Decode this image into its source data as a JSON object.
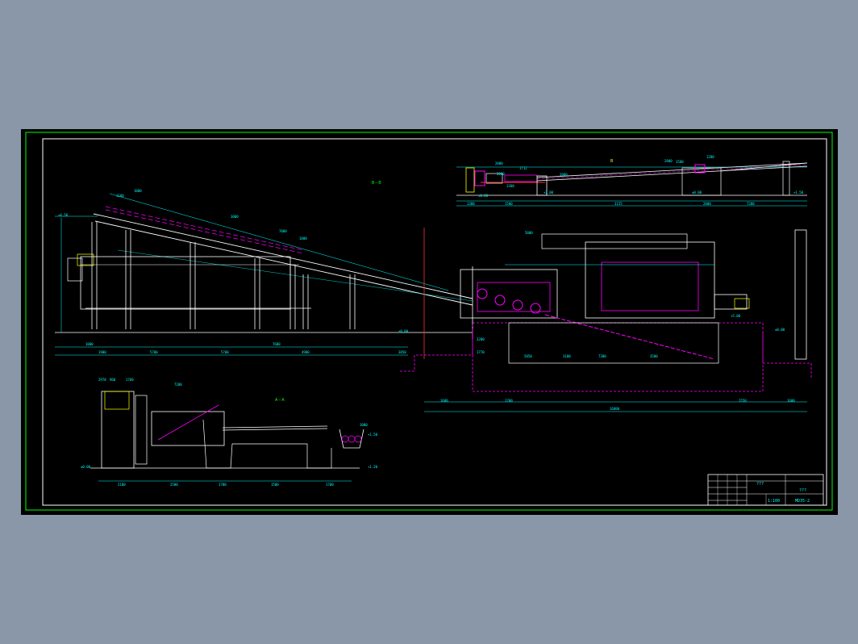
{
  "drawing": {
    "section_label_bb": "B－B",
    "section_label_aa": "A－A",
    "top_view_mark": "B",
    "top_view_mark_a": "A",
    "dims_top": [
      "2000",
      "1712",
      "2000",
      "1360",
      "1380",
      "1500",
      "3155",
      "2000",
      "7200",
      "2000",
      "1500",
      "1280",
      "2800"
    ],
    "elev_top": [
      "±0.00",
      "+2.00",
      "±0.00",
      "+1.50"
    ],
    "dims_main_upper": [
      "1100",
      "1000",
      "3000",
      "7000",
      "1000",
      "5000"
    ],
    "dims_main_lower": [
      "1000",
      "1900",
      "5700",
      "5700",
      "7600",
      "4900",
      "3850",
      "3200",
      "1770",
      "5850",
      "3100",
      "7300",
      "3500",
      "1600",
      "1700",
      "1550",
      "1600"
    ],
    "dims_main_total": "16000",
    "elev_main": [
      "+4.50",
      "±0.00",
      "+5.00",
      "±0.00"
    ],
    "dims_aa": [
      "7200",
      "2970",
      "960",
      "1760",
      "1000",
      "2100",
      "2500",
      "1700",
      "1500",
      "1700"
    ],
    "elev_aa": [
      "±0.00",
      "+1.50",
      "+1.20"
    ],
    "colors": {
      "background": "#000000",
      "frame": "#00ff00",
      "lines_white": "#ffffff",
      "dims_cyan": "#00ffff",
      "hidden_magenta": "#ff00ff",
      "accent_red": "#ff3030",
      "accent_yellow": "#ffff00"
    }
  },
  "title_block": {
    "name_label": "???",
    "project_label": "???",
    "drawing_no": "MD35-2",
    "scale_label": "1:100"
  }
}
